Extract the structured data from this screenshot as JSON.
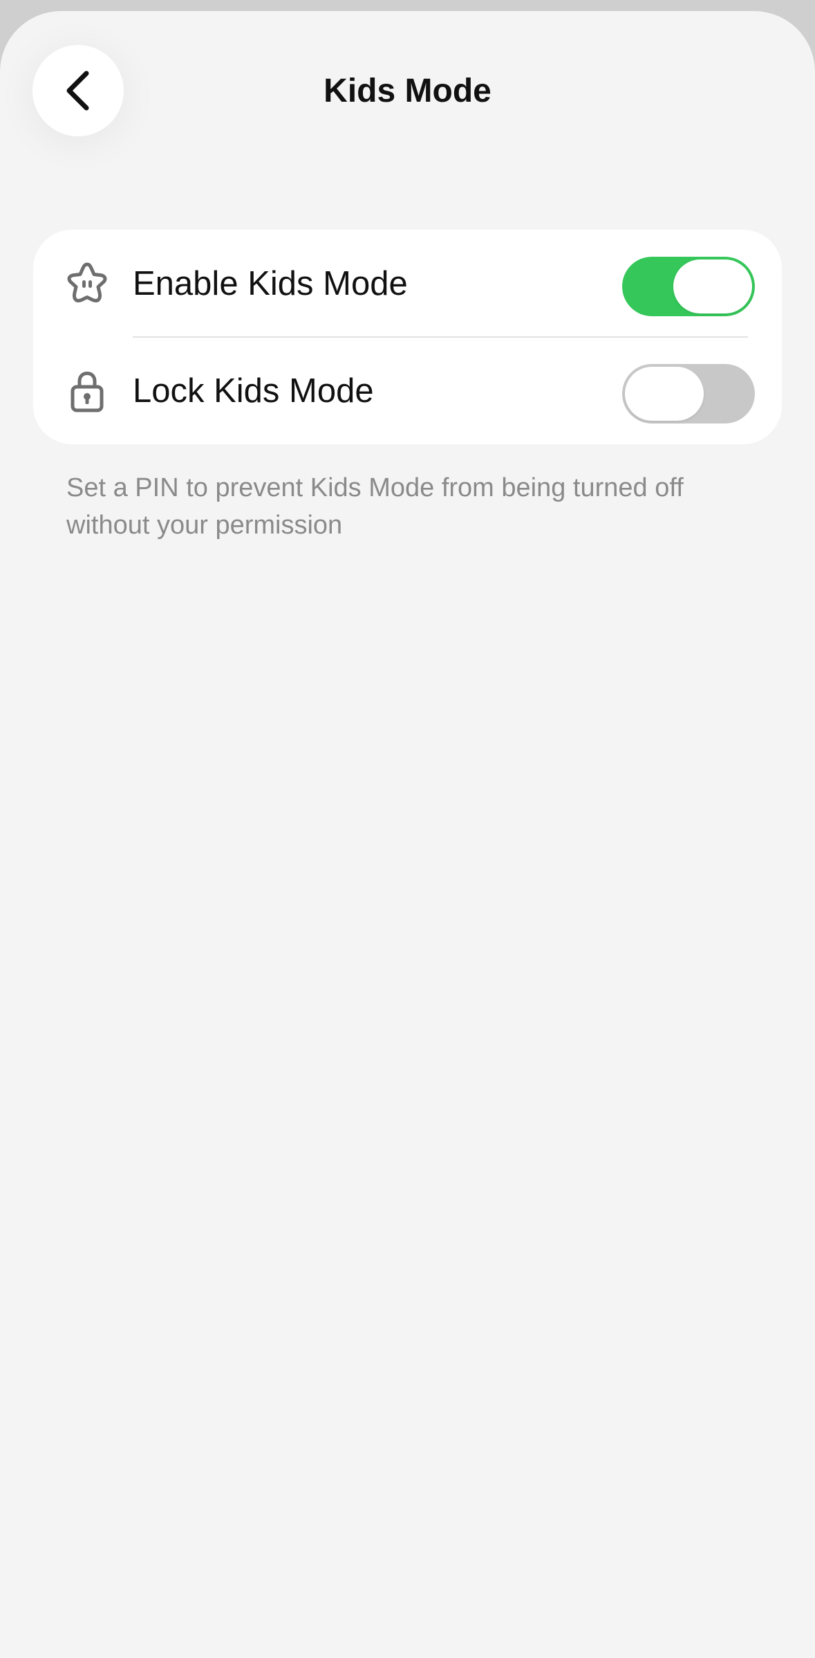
{
  "header": {
    "title": "Kids Mode",
    "back_icon": "chevron-left-icon"
  },
  "settings": {
    "rows": [
      {
        "label": "Enable Kids Mode",
        "icon": "star-face-icon",
        "toggle_on": true
      },
      {
        "label": "Lock Kids Mode",
        "icon": "lock-icon",
        "toggle_on": false
      }
    ],
    "footnote": "Set a PIN to prevent Kids Mode from being turned off without your permission"
  },
  "colors": {
    "background": "#f4f4f4",
    "card": "#ffffff",
    "toggle_on": "#35c759",
    "toggle_off": "#c8c8c8",
    "footnote": "#8a8a8a"
  }
}
